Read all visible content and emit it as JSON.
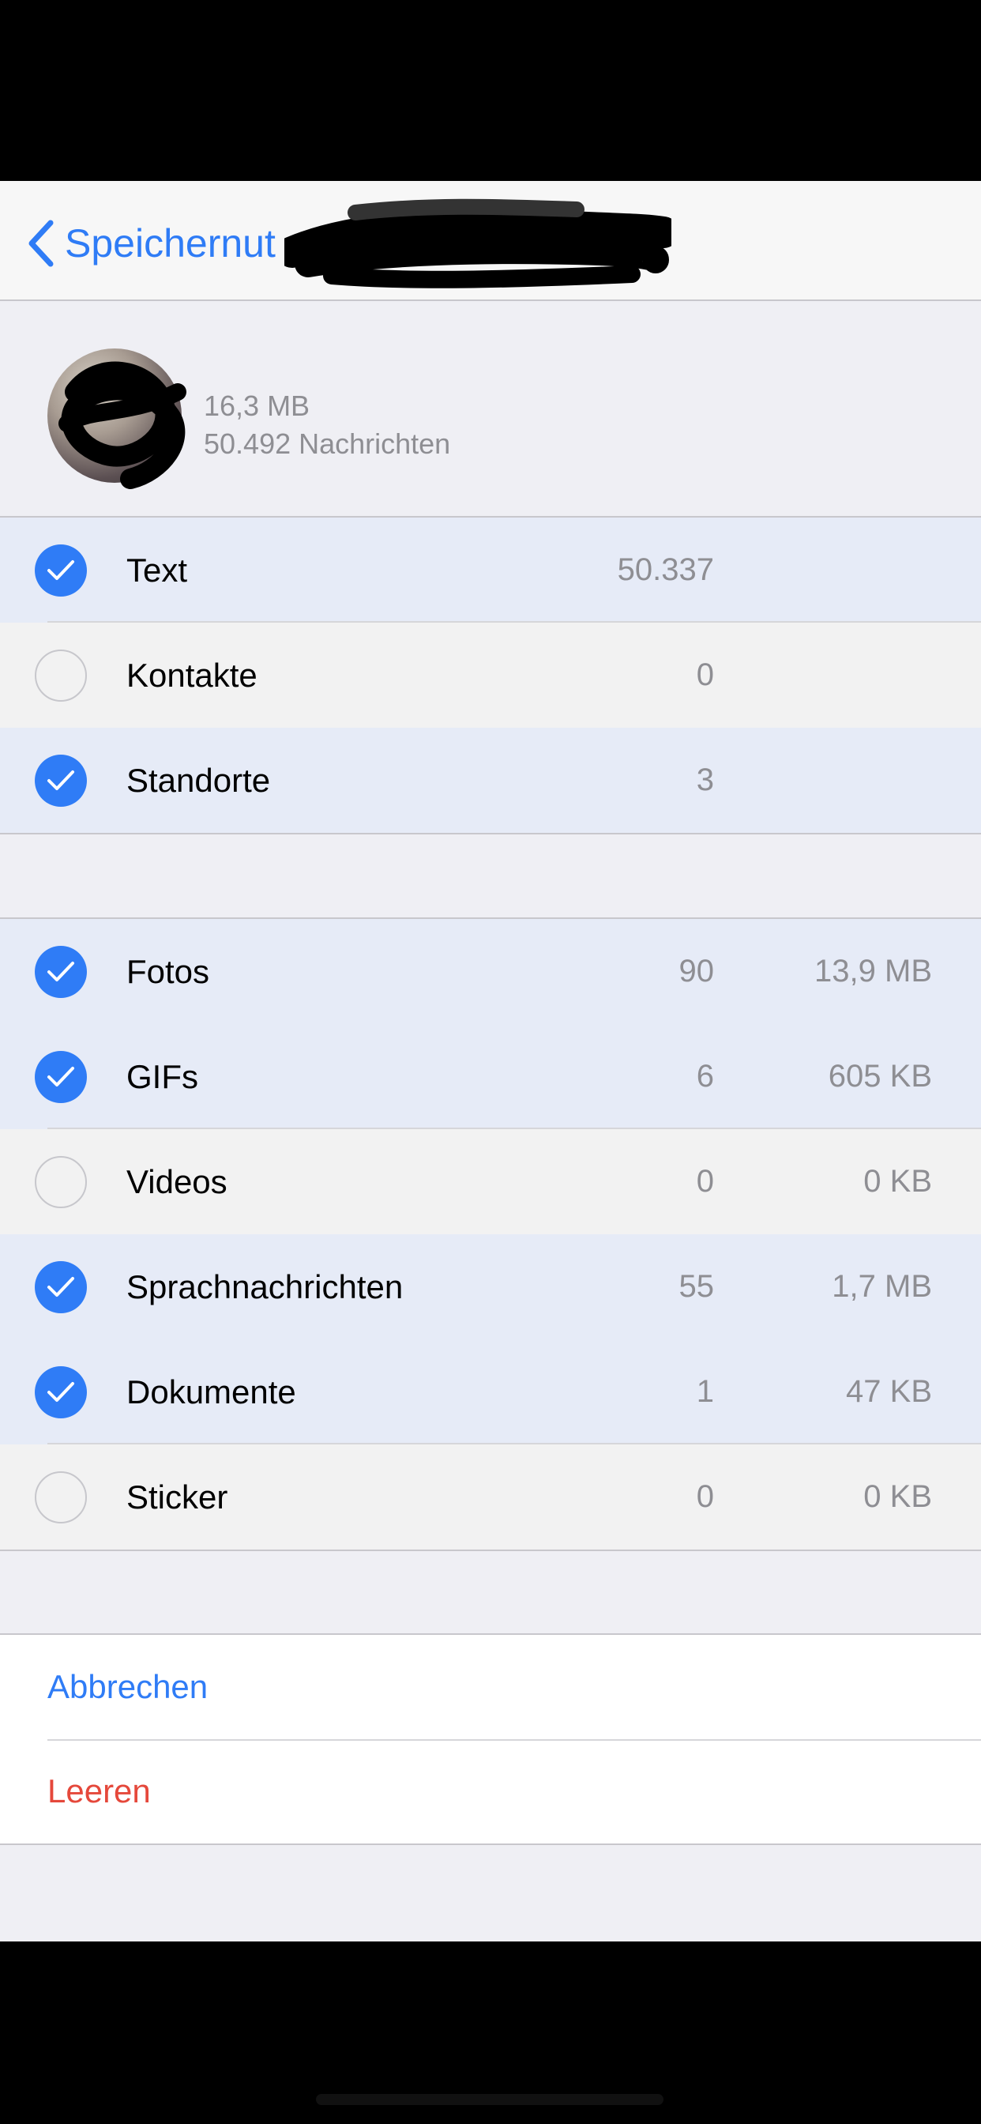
{
  "colors": {
    "accent": "#2f7cf6",
    "destructive": "#e5483b",
    "checked_row": "#e6ebf7",
    "unchecked_row": "#f2f2f2",
    "secondary_text": "#8e8e93"
  },
  "navbar": {
    "back_label": "Speichernut",
    "back_icon": "chevron-left-icon"
  },
  "chat": {
    "size": "16,3 MB",
    "message_count": "50.492 Nachrichten"
  },
  "groups": [
    {
      "rows": [
        {
          "label": "Text",
          "count": "50.337",
          "size": "",
          "checked": true
        },
        {
          "label": "Kontakte",
          "count": "0",
          "size": "",
          "checked": false
        },
        {
          "label": "Standorte",
          "count": "3",
          "size": "",
          "checked": true
        }
      ]
    },
    {
      "rows": [
        {
          "label": "Fotos",
          "count": "90",
          "size": "13,9 MB",
          "checked": true
        },
        {
          "label": "GIFs",
          "count": "6",
          "size": "605 KB",
          "checked": true
        },
        {
          "label": "Videos",
          "count": "0",
          "size": "0 KB",
          "checked": false
        },
        {
          "label": "Sprachnachrichten",
          "count": "55",
          "size": "1,7 MB",
          "checked": true
        },
        {
          "label": "Dokumente",
          "count": "1",
          "size": "47 KB",
          "checked": true
        },
        {
          "label": "Sticker",
          "count": "0",
          "size": "0 KB",
          "checked": false
        }
      ]
    }
  ],
  "actions": {
    "cancel": "Abbrechen",
    "clear": "Leeren"
  }
}
